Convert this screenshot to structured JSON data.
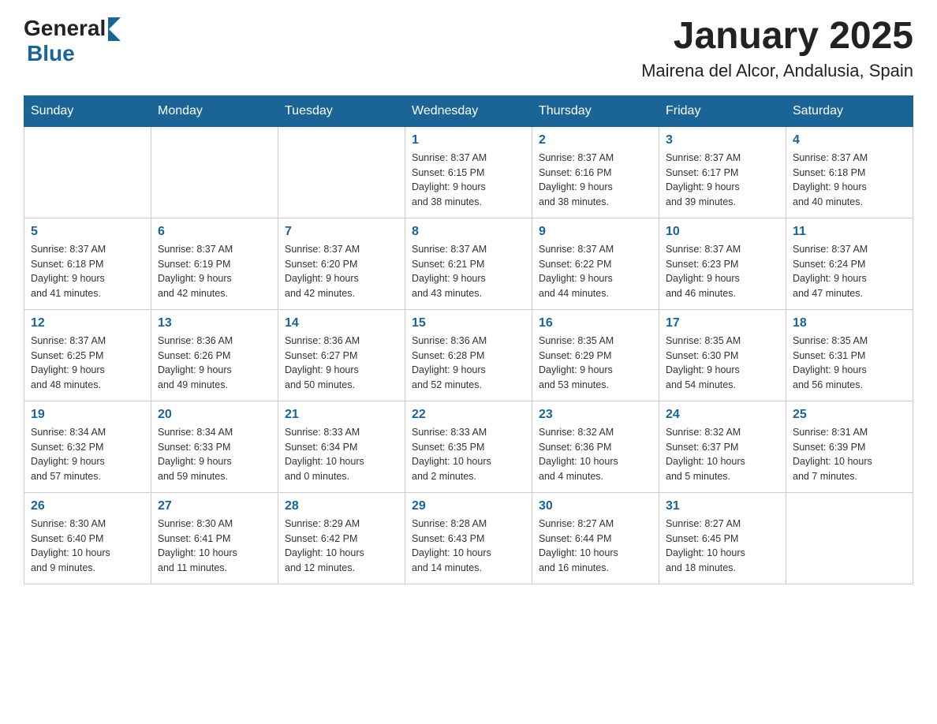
{
  "header": {
    "logo_general": "General",
    "logo_blue": "Blue",
    "title": "January 2025",
    "subtitle": "Mairena del Alcor, Andalusia, Spain"
  },
  "colors": {
    "header_bg": "#1a6496",
    "accent": "#1a6496"
  },
  "weekdays": [
    "Sunday",
    "Monday",
    "Tuesday",
    "Wednesday",
    "Thursday",
    "Friday",
    "Saturday"
  ],
  "weeks": [
    {
      "days": [
        {
          "number": "",
          "info": ""
        },
        {
          "number": "",
          "info": ""
        },
        {
          "number": "",
          "info": ""
        },
        {
          "number": "1",
          "info": "Sunrise: 8:37 AM\nSunset: 6:15 PM\nDaylight: 9 hours\nand 38 minutes."
        },
        {
          "number": "2",
          "info": "Sunrise: 8:37 AM\nSunset: 6:16 PM\nDaylight: 9 hours\nand 38 minutes."
        },
        {
          "number": "3",
          "info": "Sunrise: 8:37 AM\nSunset: 6:17 PM\nDaylight: 9 hours\nand 39 minutes."
        },
        {
          "number": "4",
          "info": "Sunrise: 8:37 AM\nSunset: 6:18 PM\nDaylight: 9 hours\nand 40 minutes."
        }
      ]
    },
    {
      "days": [
        {
          "number": "5",
          "info": "Sunrise: 8:37 AM\nSunset: 6:18 PM\nDaylight: 9 hours\nand 41 minutes."
        },
        {
          "number": "6",
          "info": "Sunrise: 8:37 AM\nSunset: 6:19 PM\nDaylight: 9 hours\nand 42 minutes."
        },
        {
          "number": "7",
          "info": "Sunrise: 8:37 AM\nSunset: 6:20 PM\nDaylight: 9 hours\nand 42 minutes."
        },
        {
          "number": "8",
          "info": "Sunrise: 8:37 AM\nSunset: 6:21 PM\nDaylight: 9 hours\nand 43 minutes."
        },
        {
          "number": "9",
          "info": "Sunrise: 8:37 AM\nSunset: 6:22 PM\nDaylight: 9 hours\nand 44 minutes."
        },
        {
          "number": "10",
          "info": "Sunrise: 8:37 AM\nSunset: 6:23 PM\nDaylight: 9 hours\nand 46 minutes."
        },
        {
          "number": "11",
          "info": "Sunrise: 8:37 AM\nSunset: 6:24 PM\nDaylight: 9 hours\nand 47 minutes."
        }
      ]
    },
    {
      "days": [
        {
          "number": "12",
          "info": "Sunrise: 8:37 AM\nSunset: 6:25 PM\nDaylight: 9 hours\nand 48 minutes."
        },
        {
          "number": "13",
          "info": "Sunrise: 8:36 AM\nSunset: 6:26 PM\nDaylight: 9 hours\nand 49 minutes."
        },
        {
          "number": "14",
          "info": "Sunrise: 8:36 AM\nSunset: 6:27 PM\nDaylight: 9 hours\nand 50 minutes."
        },
        {
          "number": "15",
          "info": "Sunrise: 8:36 AM\nSunset: 6:28 PM\nDaylight: 9 hours\nand 52 minutes."
        },
        {
          "number": "16",
          "info": "Sunrise: 8:35 AM\nSunset: 6:29 PM\nDaylight: 9 hours\nand 53 minutes."
        },
        {
          "number": "17",
          "info": "Sunrise: 8:35 AM\nSunset: 6:30 PM\nDaylight: 9 hours\nand 54 minutes."
        },
        {
          "number": "18",
          "info": "Sunrise: 8:35 AM\nSunset: 6:31 PM\nDaylight: 9 hours\nand 56 minutes."
        }
      ]
    },
    {
      "days": [
        {
          "number": "19",
          "info": "Sunrise: 8:34 AM\nSunset: 6:32 PM\nDaylight: 9 hours\nand 57 minutes."
        },
        {
          "number": "20",
          "info": "Sunrise: 8:34 AM\nSunset: 6:33 PM\nDaylight: 9 hours\nand 59 minutes."
        },
        {
          "number": "21",
          "info": "Sunrise: 8:33 AM\nSunset: 6:34 PM\nDaylight: 10 hours\nand 0 minutes."
        },
        {
          "number": "22",
          "info": "Sunrise: 8:33 AM\nSunset: 6:35 PM\nDaylight: 10 hours\nand 2 minutes."
        },
        {
          "number": "23",
          "info": "Sunrise: 8:32 AM\nSunset: 6:36 PM\nDaylight: 10 hours\nand 4 minutes."
        },
        {
          "number": "24",
          "info": "Sunrise: 8:32 AM\nSunset: 6:37 PM\nDaylight: 10 hours\nand 5 minutes."
        },
        {
          "number": "25",
          "info": "Sunrise: 8:31 AM\nSunset: 6:39 PM\nDaylight: 10 hours\nand 7 minutes."
        }
      ]
    },
    {
      "days": [
        {
          "number": "26",
          "info": "Sunrise: 8:30 AM\nSunset: 6:40 PM\nDaylight: 10 hours\nand 9 minutes."
        },
        {
          "number": "27",
          "info": "Sunrise: 8:30 AM\nSunset: 6:41 PM\nDaylight: 10 hours\nand 11 minutes."
        },
        {
          "number": "28",
          "info": "Sunrise: 8:29 AM\nSunset: 6:42 PM\nDaylight: 10 hours\nand 12 minutes."
        },
        {
          "number": "29",
          "info": "Sunrise: 8:28 AM\nSunset: 6:43 PM\nDaylight: 10 hours\nand 14 minutes."
        },
        {
          "number": "30",
          "info": "Sunrise: 8:27 AM\nSunset: 6:44 PM\nDaylight: 10 hours\nand 16 minutes."
        },
        {
          "number": "31",
          "info": "Sunrise: 8:27 AM\nSunset: 6:45 PM\nDaylight: 10 hours\nand 18 minutes."
        },
        {
          "number": "",
          "info": ""
        }
      ]
    }
  ]
}
